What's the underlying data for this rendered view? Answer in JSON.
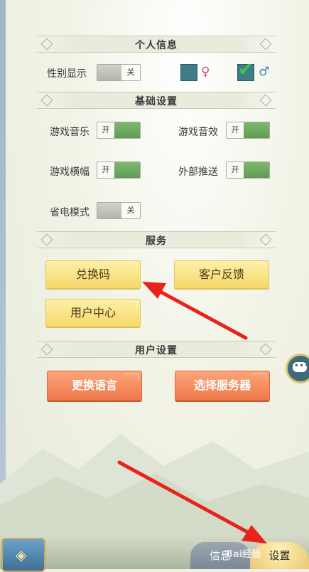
{
  "sections": {
    "personal": "个人信息",
    "basic": "基础设置",
    "service": "服务",
    "user": "用户设置"
  },
  "personal": {
    "gender_label": "性别显示",
    "gender_toggle": "关",
    "female_symbol": "♀",
    "male_symbol": "♂",
    "check_symbol": "✔"
  },
  "basic": {
    "music_label": "游戏音乐",
    "music_toggle": "开",
    "sound_label": "游戏音效",
    "sound_toggle": "开",
    "banner_label": "游戏横幅",
    "banner_toggle": "开",
    "push_label": "外部推送",
    "push_toggle": "开",
    "power_label": "省电模式",
    "power_toggle": "关"
  },
  "service": {
    "redeem": "兑换码",
    "feedback": "客户反馈",
    "user_center": "用户中心"
  },
  "user": {
    "language": "更换语言",
    "server": "选择服务器"
  },
  "bottom": {
    "info_tab": "信息",
    "settings_tab": "设置",
    "watermark": "Bai经验"
  },
  "colors": {
    "toggle_on": "#5f9c52",
    "button_yellow": "#f5d86a",
    "button_orange": "#f07a4c",
    "arrow_red": "#e8231c"
  }
}
